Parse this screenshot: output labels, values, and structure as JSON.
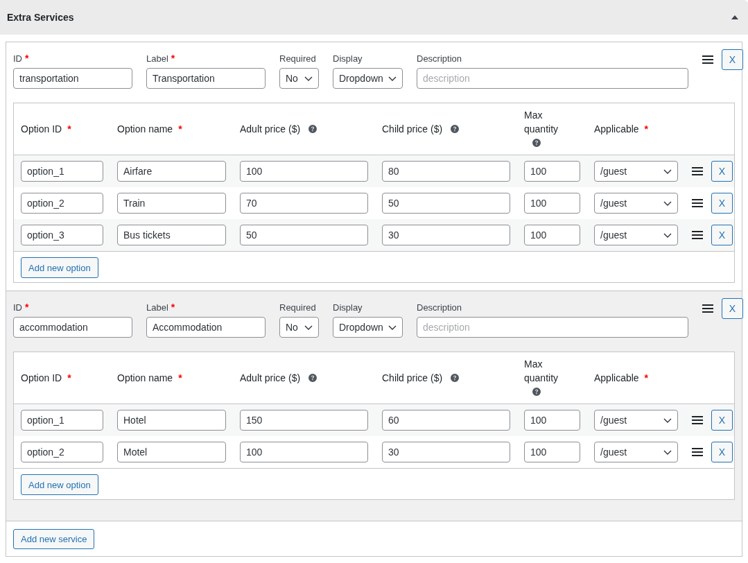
{
  "panel": {
    "title": "Extra Services",
    "expanded": true
  },
  "services": [
    {
      "fields": [
        {
          "kind": "text",
          "label": "ID",
          "required_mark": "*",
          "value": "transportation"
        },
        {
          "kind": "text",
          "label": "Label",
          "required_mark": "*",
          "value": "Transportation"
        },
        {
          "kind": "select",
          "label": "Required",
          "value": "No"
        },
        {
          "kind": "select",
          "label": "Display",
          "value": "Dropdown"
        },
        {
          "kind": "text",
          "label": "Description",
          "placeholder": "description"
        }
      ],
      "remove_button": "X",
      "options_table": {
        "columns": [
          {
            "kind": "text",
            "label": "Option ID",
            "required_mark": "*"
          },
          {
            "kind": "text",
            "label": "Option name",
            "required_mark": "*"
          },
          {
            "kind": "text",
            "label": "Adult price ($)",
            "help": true
          },
          {
            "kind": "text",
            "label": "Child price ($)",
            "help": true
          },
          {
            "kind": "text",
            "label": "Max quantity",
            "help": true
          },
          {
            "kind": "select",
            "label": "Applicable",
            "required_mark": "*"
          }
        ],
        "rows": [
          {
            "cells": [
              "option_1",
              "Airfare",
              "100",
              "80",
              "100",
              "/guest"
            ],
            "remove_button": "X"
          },
          {
            "cells": [
              "option_2",
              "Train",
              "70",
              "50",
              "100",
              "/guest"
            ],
            "remove_button": "X"
          },
          {
            "cells": [
              "option_3",
              "Bus tickets",
              "50",
              "30",
              "100",
              "/guest"
            ],
            "remove_button": "X"
          }
        ],
        "add_button": "Add new option"
      }
    },
    {
      "fields": [
        {
          "kind": "text",
          "label": "ID",
          "required_mark": "*",
          "value": "accommodation"
        },
        {
          "kind": "text",
          "label": "Label",
          "required_mark": "*",
          "value": "Accommodation"
        },
        {
          "kind": "select",
          "label": "Required",
          "value": "No"
        },
        {
          "kind": "select",
          "label": "Display",
          "value": "Dropdown"
        },
        {
          "kind": "text",
          "label": "Description",
          "placeholder": "description"
        }
      ],
      "remove_button": "X",
      "options_table": {
        "columns": [
          {
            "kind": "text",
            "label": "Option ID",
            "required_mark": "*"
          },
          {
            "kind": "text",
            "label": "Option name",
            "required_mark": "*"
          },
          {
            "kind": "text",
            "label": "Adult price ($)",
            "help": true
          },
          {
            "kind": "text",
            "label": "Child price ($)",
            "help": true
          },
          {
            "kind": "text",
            "label": "Max quantity",
            "help": true
          },
          {
            "kind": "select",
            "label": "Applicable",
            "required_mark": "*"
          }
        ],
        "rows": [
          {
            "cells": [
              "option_1",
              "Hotel",
              "150",
              "60",
              "100",
              "/guest"
            ],
            "remove_button": "X"
          },
          {
            "cells": [
              "option_2",
              "Motel",
              "100",
              "30",
              "100",
              "/guest"
            ],
            "remove_button": "X"
          }
        ],
        "add_button": "Add new option"
      }
    }
  ],
  "add_button": "Add new service"
}
